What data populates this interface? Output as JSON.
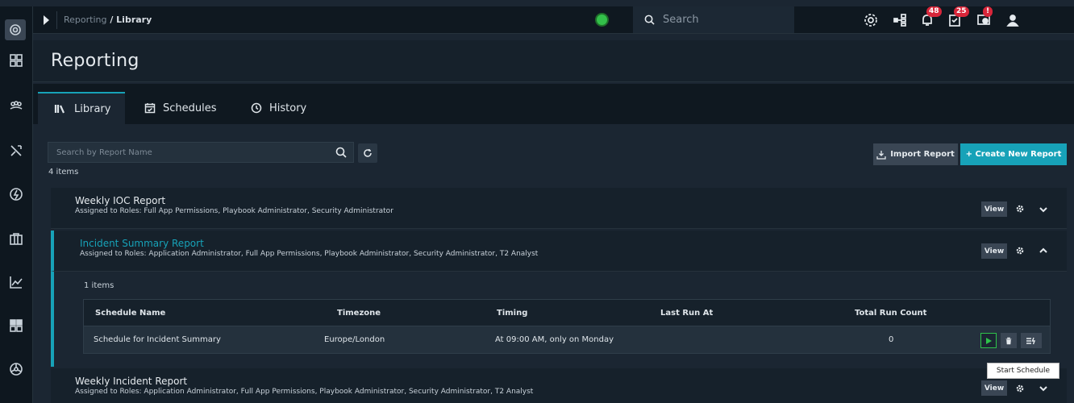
{
  "topbar": {
    "breadcrumb_parent": "Reporting",
    "breadcrumb_sep": " / ",
    "breadcrumb_current": "Library",
    "search_placeholder": "Search",
    "notifications_badge": "48",
    "tasks_badge": "25",
    "system_badge": "!"
  },
  "page": {
    "title": "Reporting"
  },
  "tabs": [
    {
      "label": "Library",
      "icon": "library-icon",
      "active": true
    },
    {
      "label": "Schedules",
      "icon": "calendar-check-icon",
      "active": false
    },
    {
      "label": "History",
      "icon": "history-icon",
      "active": false
    }
  ],
  "toolbar": {
    "search_placeholder": "Search by Report Name",
    "items_count": "4 items",
    "import_label": "Import Report",
    "create_label": "+ Create New Report"
  },
  "reports": [
    {
      "name": "Weekly IOC Report",
      "roles": "Assigned to Roles: Full App Permissions, Playbook Administrator, Security Administrator",
      "view_label": "View",
      "expanded": false
    },
    {
      "name": "Incident Summary Report",
      "roles": "Assigned to Roles: Application Administrator, Full App Permissions, Playbook Administrator, Security Administrator, T2 Analyst",
      "view_label": "View",
      "expanded": true
    },
    {
      "name": "Weekly Incident Report",
      "roles": "Assigned to Roles: Application Administrator, Full App Permissions, Playbook Administrator, Security Administrator, T2 Analyst",
      "view_label": "View",
      "expanded": false
    }
  ],
  "schedules": {
    "count": "1 items",
    "columns": [
      "Schedule Name",
      "Timezone",
      "Timing",
      "Last Run At",
      "Total Run Count"
    ],
    "rows": [
      {
        "name": "Schedule for Incident Summary",
        "timezone": "Europe/London",
        "timing": "At 09:00 AM, only on Monday",
        "last_run": "",
        "run_count": "0"
      }
    ]
  },
  "tooltip": "Start Schedule",
  "colors": {
    "accent": "#17a2b8",
    "badge": "#d8263a",
    "play_green": "#2ec24a"
  }
}
